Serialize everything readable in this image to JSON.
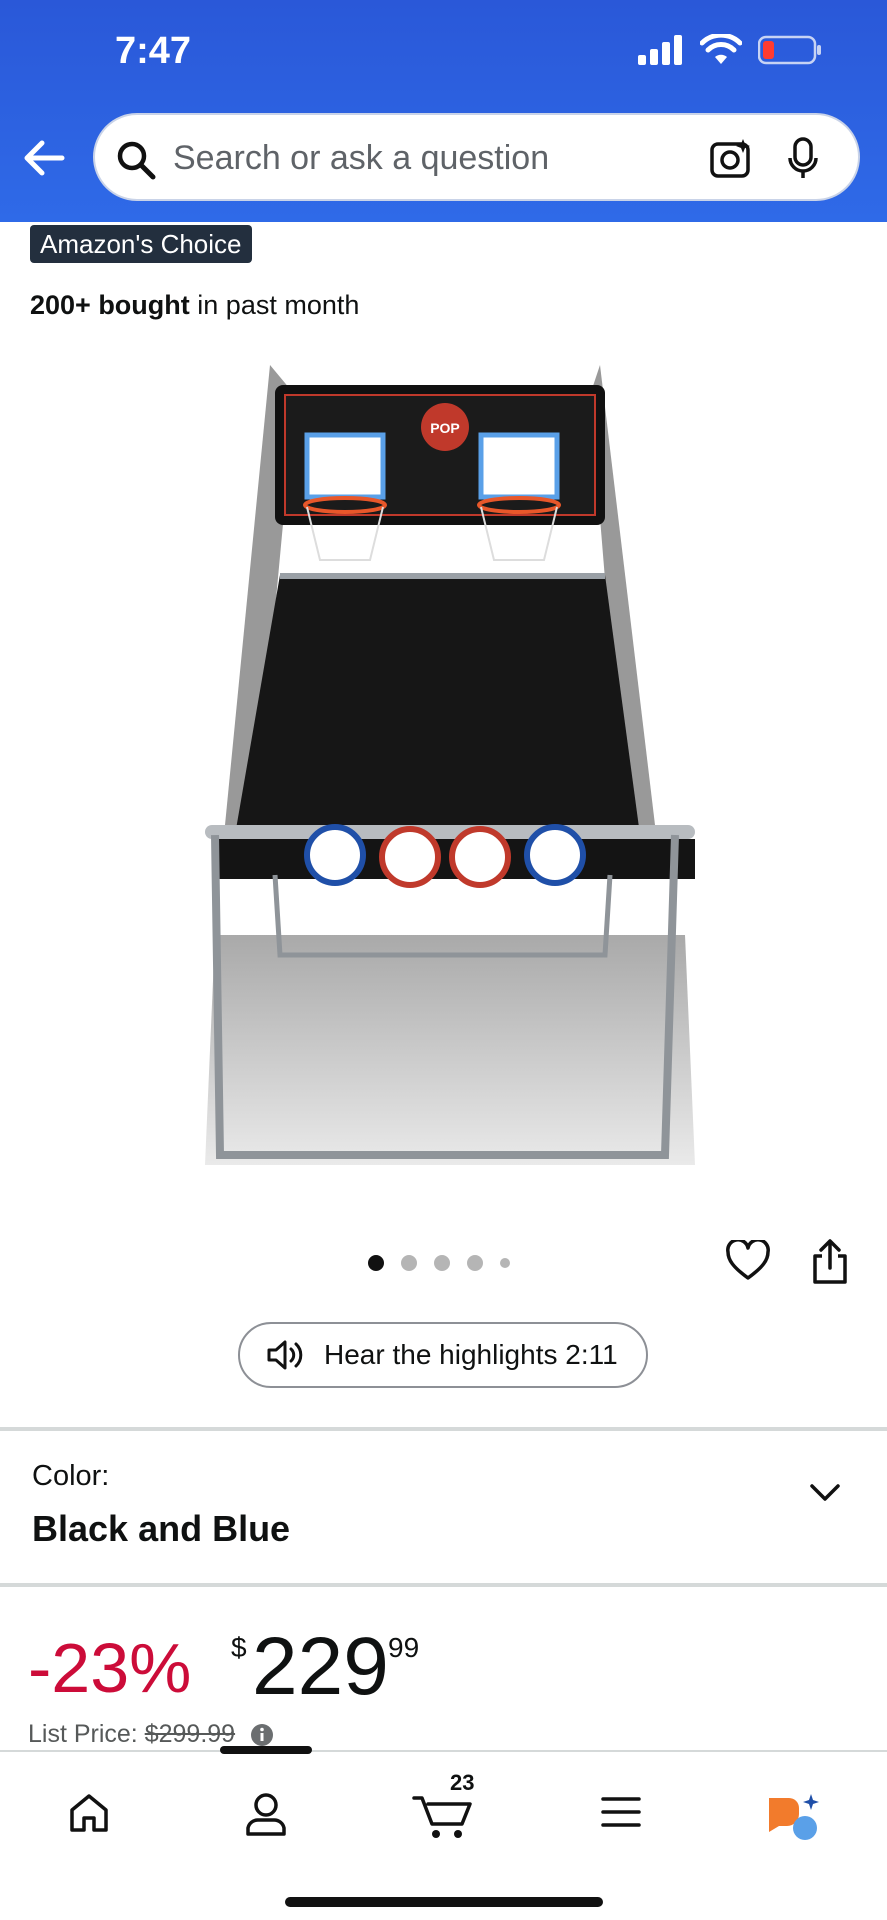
{
  "status_bar": {
    "time": "7:47"
  },
  "search": {
    "placeholder": "Search or ask a question"
  },
  "badge": {
    "label": "Amazon's Choice"
  },
  "social_proof": {
    "bold": "200+ bought",
    "rest": " in past month"
  },
  "product": {
    "image_alt": "Pop-A-Shot Sport dual basketball arcade game"
  },
  "carousel": {
    "total_dots": 5,
    "active_index": 0
  },
  "audio": {
    "label": "Hear the highlights 2:11"
  },
  "color": {
    "label": "Color:",
    "value": "Black and Blue"
  },
  "price": {
    "discount": "-23%",
    "currency": "$",
    "whole": "229",
    "fraction": "99",
    "list_label": "List Price: ",
    "list_value": "$299.99"
  },
  "nav": {
    "cart_count": "23"
  },
  "colors": {
    "header": "#2a58d8",
    "discount": "#cc0c39",
    "badge": "#232f3e"
  },
  "icons": [
    "back-arrow-icon",
    "search-icon",
    "camera-icon",
    "mic-icon",
    "heart-icon",
    "share-icon",
    "speaker-icon",
    "chevron-down-icon",
    "info-icon",
    "home-icon",
    "account-icon",
    "cart-icon",
    "menu-icon",
    "rufus-icon"
  ]
}
